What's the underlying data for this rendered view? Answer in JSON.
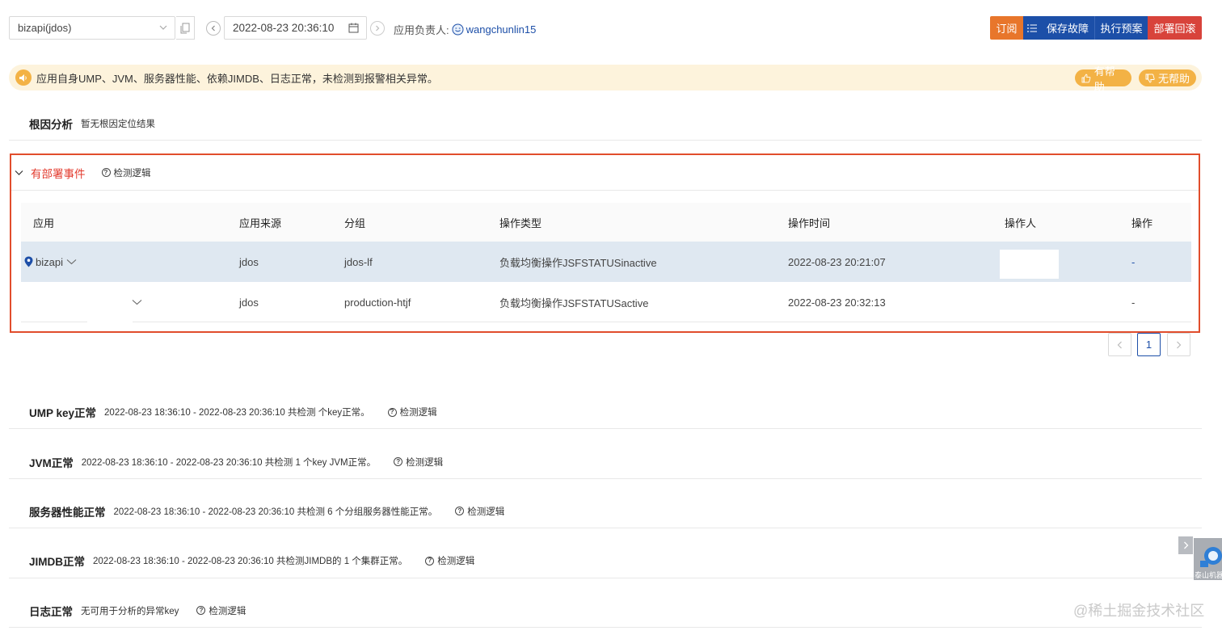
{
  "toolbar": {
    "app_select_value": "bizapi(jdos)",
    "datetime_value": "2022-08-23 20:36:10",
    "owner_label": "应用负责人:",
    "owner_name": "wangchunlin15",
    "subscribe_label": "订阅",
    "save_fault_label": "保存故障",
    "exec_plan_label": "执行预案",
    "rollback_label": "部署回滚"
  },
  "notice": {
    "text": "应用自身UMP、JVM、服务器性能、依赖JIMDB、日志正常，未检测到报警相关异常。",
    "helpful_label": "有帮助",
    "unhelpful_label": "无帮助"
  },
  "root_cause": {
    "title": "根因分析",
    "desc": "暂无根因定位结果"
  },
  "deploy": {
    "title": "有部署事件",
    "logic_label": "检测逻辑",
    "columns": [
      "应用",
      "应用来源",
      "分组",
      "操作类型",
      "操作时间",
      "操作人",
      "操作"
    ],
    "rows": [
      {
        "app": "bizapi",
        "source": "jdos",
        "group": "jdos-lf",
        "type": "负载均衡操作JSFSTATUSinactive",
        "time": "2022-08-23 20:21:07",
        "action": "-"
      },
      {
        "app": "",
        "source": "jdos",
        "group": "production-htjf",
        "type": "负载均衡操作JSFSTATUSactive",
        "time": "2022-08-23 20:32:13",
        "action": "-"
      }
    ]
  },
  "pagination": {
    "current": "1"
  },
  "sections": [
    {
      "title": "UMP key正常",
      "desc": "2022-08-23 18:36:10 - 2022-08-23 20:36:10 共检测 个key正常。",
      "logic": "检测逻辑"
    },
    {
      "title": "JVM正常",
      "desc": "2022-08-23 18:36:10 - 2022-08-23 20:36:10 共检测 1 个key JVM正常。",
      "logic": "检测逻辑"
    },
    {
      "title": "服务器性能正常",
      "desc": "2022-08-23 18:36:10 - 2022-08-23 20:36:10 共检测 6 个分组服务器性能正常。",
      "logic": "检测逻辑"
    },
    {
      "title": "JIMDB正常",
      "desc": "2022-08-23 18:36:10 - 2022-08-23 20:36:10 共检测JIMDB的 1 个集群正常。",
      "logic": "检测逻辑"
    },
    {
      "title": "日志正常",
      "desc": "无可用于分析的异常key",
      "logic": "检测逻辑"
    }
  ],
  "floating": {
    "robot_label": "泰山机器人"
  },
  "watermark": "@稀土掘金技术社区",
  "colors": {
    "primary": "#1c4fa8",
    "orange": "#e8762b",
    "danger": "#d8433b",
    "highlight_border": "#e14d2c",
    "notice_bg": "#fdf3dc"
  },
  "icons": [
    "chevron-down-icon",
    "copy-icon",
    "prev-circle-icon",
    "calendar-icon",
    "next-circle-icon",
    "smile-avatar-icon",
    "list-icon",
    "speaker-icon",
    "thumb-up-icon",
    "thumb-down-icon",
    "question-circle-icon",
    "location-pin-icon",
    "chevron-left-icon",
    "chevron-right-icon",
    "robot-icon"
  ]
}
